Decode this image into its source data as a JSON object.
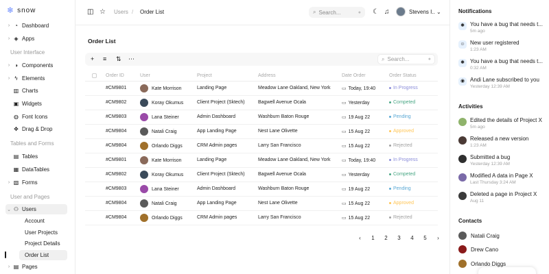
{
  "brand": {
    "name": "snow"
  },
  "sidebar": {
    "items_top": [
      {
        "label": "Dashboard",
        "icon": "pie-chart-icon"
      },
      {
        "label": "Apps",
        "icon": "cube-icon"
      }
    ],
    "section_ui": "User Interface",
    "items_ui": [
      {
        "label": "Components",
        "icon": "components-icon"
      },
      {
        "label": "Elements",
        "icon": "bolt-icon"
      },
      {
        "label": "Charts",
        "icon": "bar-chart-icon"
      },
      {
        "label": "Widgets",
        "icon": "widgets-icon"
      },
      {
        "label": "Font Icons",
        "icon": "globe-icon"
      },
      {
        "label": "Drag & Drop",
        "icon": "drag-icon"
      }
    ],
    "section_tables": "Tables and Forms",
    "items_tables": [
      {
        "label": "Tables",
        "icon": "table-icon"
      },
      {
        "label": "DataTables",
        "icon": "datatable-icon"
      },
      {
        "label": "Forms",
        "icon": "forms-icon"
      }
    ],
    "section_users": "User and Pages",
    "users_label": "Users",
    "users_sub": [
      "Account",
      "User Projects",
      "Project Details",
      "Order List"
    ],
    "pages_label": "Pages"
  },
  "topbar": {
    "crumb_parent": "Users",
    "crumb_sep": "/",
    "crumb_current": "Order List",
    "search_placeholder": "Search...",
    "user_name": "Stevens I.."
  },
  "main": {
    "title": "Order List",
    "search_placeholder": "Search...",
    "columns": [
      "Order ID",
      "User",
      "Project",
      "Address",
      "Date Order",
      "Order Status"
    ],
    "rows": [
      {
        "id": "#CM9801",
        "user": "Kate Morrison",
        "project": "Landing Page",
        "address": "Meadow Lane Oakland, New York",
        "date": "Today, 19:40",
        "status": "In Progress"
      },
      {
        "id": "#CM9802",
        "user": "Koray Okumus",
        "project": "Client Project (Sktech)",
        "address": "Bagwell Avenue Ocala",
        "date": "Yesterday",
        "status": "Competed"
      },
      {
        "id": "#CM9803",
        "user": "Lana Steiner",
        "project": "Admin Dashboard",
        "address": "Washburn Baton Rouge",
        "date": "19 Aug 22",
        "status": "Pending"
      },
      {
        "id": "#CM9804",
        "user": "Natali Craig",
        "project": "App Landing Page",
        "address": "Nest Lane Olivette",
        "date": "15 Aug 22",
        "status": "Approved"
      },
      {
        "id": "#CM9804",
        "user": "Orlando Diggs",
        "project": "CRM Admin pages",
        "address": "Larry San Francisco",
        "date": "15 Aug 22",
        "status": "Rejected"
      },
      {
        "id": "#CM9801",
        "user": "Kate Morrison",
        "project": "Landing Page",
        "address": "Meadow Lane Oakland, New York",
        "date": "Today, 19:40",
        "status": "In Progress"
      },
      {
        "id": "#CM9802",
        "user": "Koray Okumus",
        "project": "Client Project (Sktech)",
        "address": "Bagwell Avenue Ocala",
        "date": "Yesterday",
        "status": "Competed"
      },
      {
        "id": "#CM9803",
        "user": "Lana Steiner",
        "project": "Admin Dashboard",
        "address": "Washburn Baton Rouge",
        "date": "19 Aug 22",
        "status": "Pending"
      },
      {
        "id": "#CM9804",
        "user": "Natali Craig",
        "project": "App Landing Page",
        "address": "Nest Lane Olivette",
        "date": "15 Aug 22",
        "status": "Approved"
      },
      {
        "id": "#CM9804",
        "user": "Orlando Diggs",
        "project": "CRM Admin pages",
        "address": "Larry San Francisco",
        "date": "15 Aug 22",
        "status": "Rejected"
      }
    ],
    "pages": [
      "1",
      "2",
      "3",
      "4",
      "5"
    ]
  },
  "status_colors": {
    "In Progress": "#8a8cd9",
    "Competed": "#4aa785",
    "Pending": "#59a8d4",
    "Approved": "#ffc555",
    "Rejected": "#a0a0a0"
  },
  "right_panel": {
    "notifications_title": "Notifications",
    "notifications": [
      {
        "text": "You have a bug that needs t...",
        "time": "5m ago",
        "icon": "bug-icon"
      },
      {
        "text": "New user registered",
        "time": "1:23 AM",
        "icon": "user-icon"
      },
      {
        "text": "You have a bug that needs t...",
        "time": "0:32 AM",
        "icon": "bug-icon"
      },
      {
        "text": "Andi Lane subscribed to you",
        "time": "Yesterday 12:39 AM",
        "icon": "broadcast-icon"
      }
    ],
    "activities_title": "Activities",
    "activities": [
      {
        "text": "Edited the details of Project X",
        "time": "5m ago"
      },
      {
        "text": "Released a new version",
        "time": "1:23 AM"
      },
      {
        "text": "Submitted a bug",
        "time": "Yesterday 12:39 AM"
      },
      {
        "text": "Modified A data in Page X",
        "time": "Last Thursday 3:24 AM"
      },
      {
        "text": "Deleted a page in Project X",
        "time": "Aug 11"
      }
    ],
    "contacts_title": "Contacts",
    "contacts": [
      "Natali Craig",
      "Drew Cano",
      "Orlando Diggs"
    ]
  }
}
